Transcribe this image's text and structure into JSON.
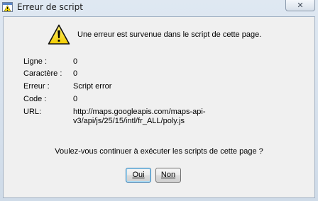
{
  "window": {
    "title": "Erreur de script",
    "close_label": "✕"
  },
  "dialog": {
    "message": "Une erreur est survenue dans le script de cette page.",
    "fields": [
      {
        "label": "Ligne :",
        "value": "0"
      },
      {
        "label": "Caractère :",
        "value": "0"
      },
      {
        "label": "Erreur :",
        "value": "Script error"
      },
      {
        "label": "Code :",
        "value": "0"
      },
      {
        "label": "URL:",
        "value": "http://maps.googleapis.com/maps-api-v3/api/js/25/15/intl/fr_ALL/poly.js"
      }
    ],
    "question": "Voulez-vous continuer à exécuter les scripts de cette page ?",
    "buttons": {
      "yes": "Oui",
      "no": "Non"
    }
  },
  "icons": {
    "title": "script-error-icon",
    "warning": "warning-icon",
    "close": "close-icon"
  },
  "colors": {
    "warning_yellow": "#f5d800",
    "default_button_border": "#3c7fb1"
  }
}
